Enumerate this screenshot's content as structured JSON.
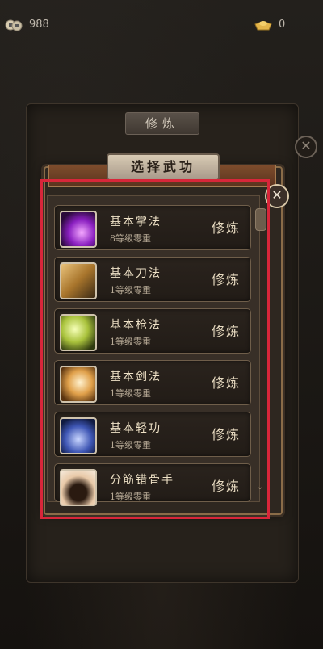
{
  "currency": {
    "coins": "988",
    "ingots": "0",
    "coin_icon": "coins-icon",
    "ingot_icon": "gold-ingot-icon"
  },
  "back_panel": {
    "tab_label": "修炼"
  },
  "dialog": {
    "title": "选择武功",
    "close_icon": "close-icon"
  },
  "skills": [
    {
      "name": "基本掌法",
      "sub": "8等级零重",
      "action": "修炼",
      "icon": "palm-skill-icon"
    },
    {
      "name": "基本刀法",
      "sub": "1等级零重",
      "action": "修炼",
      "icon": "blade-skill-icon"
    },
    {
      "name": "基本枪法",
      "sub": "1等级零重",
      "action": "修炼",
      "icon": "spear-skill-icon"
    },
    {
      "name": "基本剑法",
      "sub": "1等级零重",
      "action": "修炼",
      "icon": "sword-skill-icon"
    },
    {
      "name": "基本轻功",
      "sub": "1等级零重",
      "action": "修炼",
      "icon": "lightness-skill-icon"
    },
    {
      "name": "分筋错骨手",
      "sub": "1等级零重",
      "action": "修炼",
      "icon": "claw-skill-icon"
    }
  ],
  "colors": {
    "highlight": "#d8263a",
    "frame": "#8a6c48"
  }
}
